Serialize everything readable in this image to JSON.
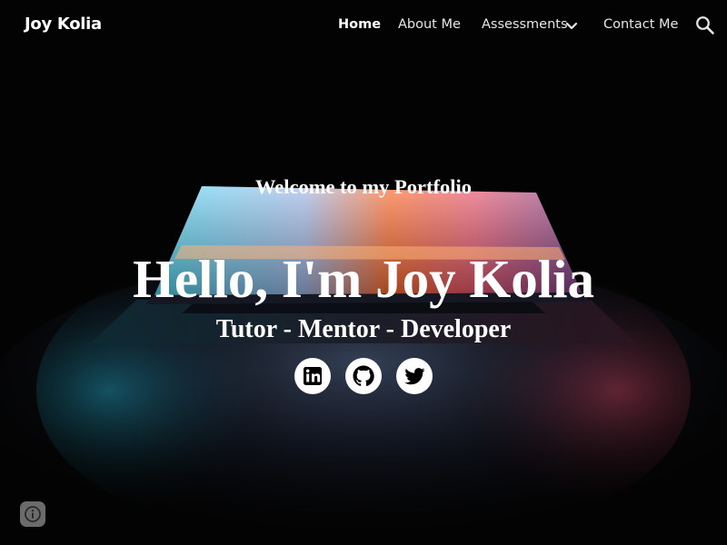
{
  "header": {
    "site_title": "Joy Kolia",
    "nav": [
      {
        "label": "Home",
        "active": true
      },
      {
        "label": "About Me",
        "active": false
      },
      {
        "label": "Assessments",
        "active": false,
        "has_dropdown": true
      },
      {
        "label": "Contact Me",
        "active": false
      }
    ],
    "search_icon": "search-icon",
    "dropdown_icon": "chevron-down-icon"
  },
  "hero": {
    "welcome": "Welcome to my Portfolio",
    "heading": "Hello, I'm Joy Kolia",
    "tagline": "Tutor - Mentor - Developer",
    "social": [
      {
        "name": "LinkedIn",
        "icon": "linkedin-icon"
      },
      {
        "name": "GitHub",
        "icon": "github-icon"
      },
      {
        "name": "Twitter",
        "icon": "twitter-icon"
      }
    ]
  },
  "footer": {
    "info_icon": "info-icon"
  },
  "colors": {
    "background": "#000000",
    "text": "#ffffff",
    "nav_text": "#e6e6e6",
    "info_button": "#6b6b6b",
    "glow_cyan": "#2ec8e6",
    "glow_orange": "#ff6a2a",
    "glow_pink": "#e9556e"
  }
}
